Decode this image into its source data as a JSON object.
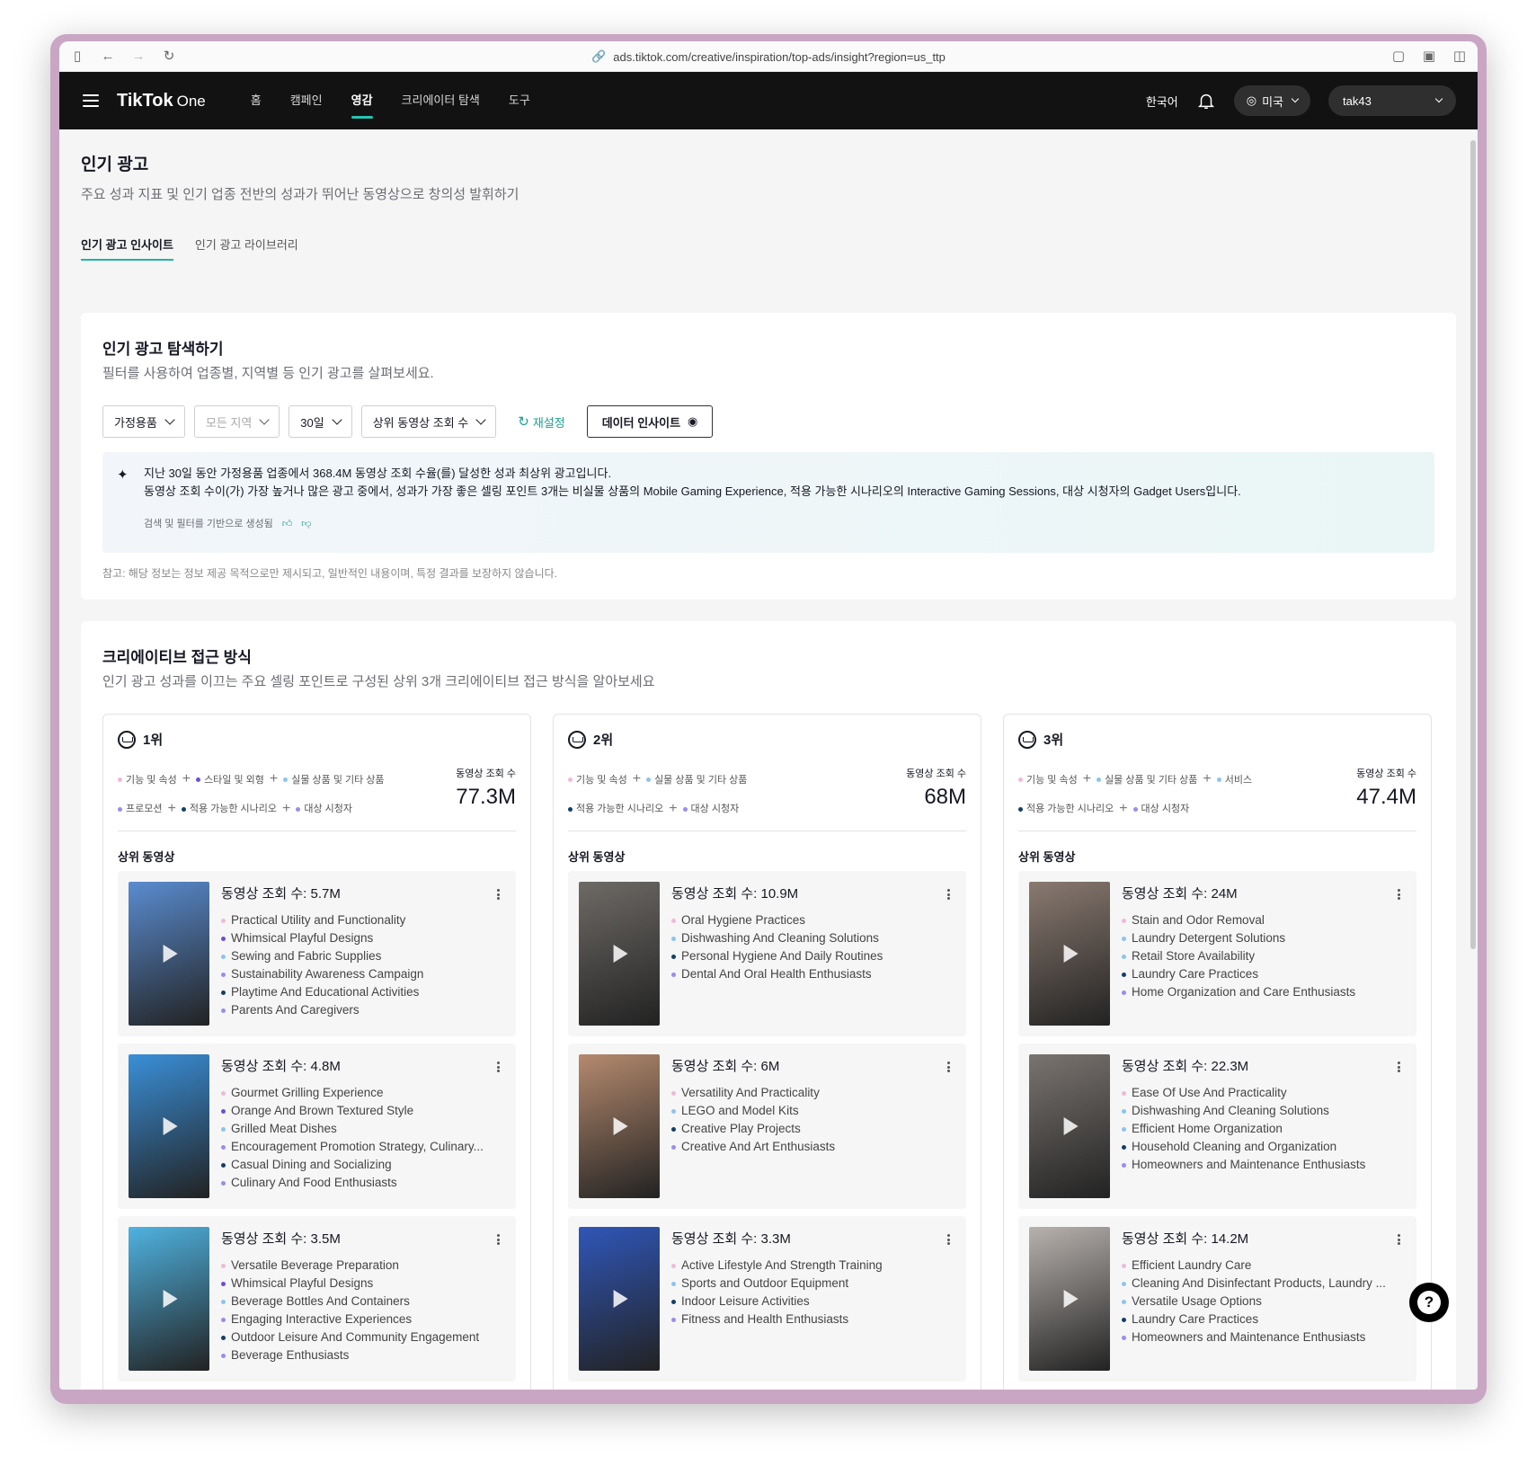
{
  "browser": {
    "url": "ads.tiktok.com/creative/inspiration/top-ads/insight?region=us_ttp"
  },
  "nav": {
    "logo_main": "TikTok",
    "logo_suffix": "One",
    "items": [
      "홈",
      "캠페인",
      "영감",
      "크리에이터 탐색",
      "도구"
    ],
    "active": "영감",
    "language": "한국어",
    "region": "미국",
    "user": "tak43"
  },
  "page": {
    "title": "인기 광고",
    "subtitle": "주요 성과 지표 및 인기 업종 전반의 성과가 뛰어난 동영상으로 창의성 발휘하기",
    "tabs": [
      "인기 광고 인사이트",
      "인기 광고 라이브러리"
    ]
  },
  "explore": {
    "title": "인기 광고 탐색하기",
    "subtitle": "필터를 사용하여 업종별, 지역별 등 인기 광고를 살펴보세요.",
    "filters": {
      "industry": "가정용품",
      "region": "모든 지역",
      "period": "30일",
      "metric": "상위 동영상 조회 수"
    },
    "reset": "재설정",
    "insight_button": "데이터 인사이트",
    "ai_line1": "지난 30일 동안 가정용품 업종에서 368.4M 동영상 조회 수율(를) 달성한 성과 최상위 광고입니다.",
    "ai_line2": "동영상 조회 수이(가) 가장 높거나 많은 광고 중에서, 성과가 가장 좋은 셀링 포인트 3개는 비실물 상품의 Mobile Gaming Experience, 적용 가능한 시나리오의 Interactive Gaming Sessions, 대상 시청자의 Gadget Users입니다.",
    "ai_meta": "검색 및 필터를 기반으로 생성됨",
    "note": "참고: 해당 정보는 정보 제공 목적으로만 제시되고, 일반적인 내용이며, 특정 결과를 보장하지 않습니다."
  },
  "approach": {
    "title": "크리에이티브 접근 방식",
    "subtitle": "인기 광고 성과를 이끄는 주요 셀링 포인트로 구성된 상위 3개 크리에이티브 접근 방식을 알아보세요",
    "views_label": "동영상 조회 수",
    "top_label": "상위 동영상",
    "colors": {
      "pink": "#f0b9d8",
      "purple": "#6a4fd6",
      "lightblue": "#8cc4f0",
      "navy": "#123f6b",
      "lavender": "#9a8cf0"
    },
    "ranks": [
      {
        "rank": "1위",
        "views": "77.3M",
        "tags_line1": [
          {
            "t": "기능 및 속성",
            "c": "pink"
          },
          {
            "t": "스타일 및 외형",
            "c": "purple"
          },
          {
            "t": "실물 상품 및 기타 상품",
            "c": "lightblue"
          }
        ],
        "tags_line2": [
          {
            "t": "프로모션",
            "c": "lavender"
          },
          {
            "t": "적용 가능한 시나리오",
            "c": "navy"
          },
          {
            "t": "대상 시청자",
            "c": "lavender"
          }
        ],
        "videos": [
          {
            "title": "동영상 조회 수: 5.7M",
            "bg": "#5a8cd0",
            "lines": [
              {
                "t": "Practical Utility and Functionality",
                "c": "pink"
              },
              {
                "t": "Whimsical Playful Designs",
                "c": "purple"
              },
              {
                "t": "Sewing and Fabric Supplies",
                "c": "lightblue"
              },
              {
                "t": "Sustainability Awareness Campaign",
                "c": "lavender"
              },
              {
                "t": "Playtime And Educational Activities",
                "c": "navy"
              },
              {
                "t": "Parents And Caregivers",
                "c": "lavender"
              }
            ]
          },
          {
            "title": "동영상 조회 수: 4.8M",
            "bg": "#3a8fd8",
            "lines": [
              {
                "t": "Gourmet Grilling Experience",
                "c": "pink"
              },
              {
                "t": "Orange And Brown Textured Style",
                "c": "purple"
              },
              {
                "t": "Grilled Meat Dishes",
                "c": "lightblue"
              },
              {
                "t": "Encouragement Promotion Strategy, Culinary...",
                "c": "lavender"
              },
              {
                "t": "Casual Dining and Socializing",
                "c": "navy"
              },
              {
                "t": "Culinary And Food Enthusiasts",
                "c": "lavender"
              }
            ]
          },
          {
            "title": "동영상 조회 수: 3.5M",
            "bg": "#4fb2e0",
            "lines": [
              {
                "t": "Versatile Beverage Preparation",
                "c": "pink"
              },
              {
                "t": "Whimsical Playful Designs",
                "c": "purple"
              },
              {
                "t": "Beverage Bottles And Containers",
                "c": "lightblue"
              },
              {
                "t": "Engaging Interactive Experiences",
                "c": "lavender"
              },
              {
                "t": "Outdoor Leisure And Community Engagement",
                "c": "navy"
              },
              {
                "t": "Beverage Enthusiasts",
                "c": "lavender"
              }
            ]
          }
        ]
      },
      {
        "rank": "2위",
        "views": "68M",
        "tags_line1": [
          {
            "t": "기능 및 속성",
            "c": "pink"
          },
          {
            "t": "실물 상품 및 기타 상품",
            "c": "lightblue"
          }
        ],
        "tags_line2": [
          {
            "t": "적용 가능한 시나리오",
            "c": "navy"
          },
          {
            "t": "대상 시청자",
            "c": "lavender"
          }
        ],
        "videos": [
          {
            "title": "동영상 조회 수: 10.9M",
            "bg": "#6e6a66",
            "lines": [
              {
                "t": "Oral Hygiene Practices",
                "c": "pink"
              },
              {
                "t": "Dishwashing And Cleaning Solutions",
                "c": "lightblue"
              },
              {
                "t": "Personal Hygiene And Daily Routines",
                "c": "navy"
              },
              {
                "t": "Dental And Oral Health Enthusiasts",
                "c": "lavender"
              }
            ]
          },
          {
            "title": "동영상 조회 수: 6M",
            "bg": "#b58a6e",
            "lines": [
              {
                "t": "Versatility And Practicality",
                "c": "pink"
              },
              {
                "t": "LEGO and Model Kits",
                "c": "lightblue"
              },
              {
                "t": "Creative Play Projects",
                "c": "navy"
              },
              {
                "t": "Creative And Art Enthusiasts",
                "c": "lavender"
              }
            ]
          },
          {
            "title": "동영상 조회 수: 3.3M",
            "bg": "#2f56b8",
            "lines": [
              {
                "t": "Active Lifestyle And Strength Training",
                "c": "pink"
              },
              {
                "t": "Sports and Outdoor Equipment",
                "c": "lightblue"
              },
              {
                "t": "Indoor Leisure Activities",
                "c": "navy"
              },
              {
                "t": "Fitness and Health Enthusiasts",
                "c": "lavender"
              }
            ]
          }
        ]
      },
      {
        "rank": "3위",
        "views": "47.4M",
        "tags_line1": [
          {
            "t": "기능 및 속성",
            "c": "pink"
          },
          {
            "t": "실물 상품 및 기타 상품",
            "c": "lightblue"
          },
          {
            "t": "서비스",
            "c": "lightblue"
          }
        ],
        "tags_line2": [
          {
            "t": "적용 가능한 시나리오",
            "c": "navy"
          },
          {
            "t": "대상 시청자",
            "c": "lavender"
          }
        ],
        "videos": [
          {
            "title": "동영상 조회 수: 24M",
            "bg": "#8a7a70",
            "lines": [
              {
                "t": "Stain and Odor Removal",
                "c": "pink"
              },
              {
                "t": "Laundry Detergent Solutions",
                "c": "lightblue"
              },
              {
                "t": "Retail Store Availability",
                "c": "lightblue"
              },
              {
                "t": "Laundry Care Practices",
                "c": "navy"
              },
              {
                "t": "Home Organization and Care Enthusiasts",
                "c": "lavender"
              }
            ]
          },
          {
            "title": "동영상 조회 수: 22.3M",
            "bg": "#7a7470",
            "lines": [
              {
                "t": "Ease Of Use And Practicality",
                "c": "pink"
              },
              {
                "t": "Dishwashing And Cleaning Solutions",
                "c": "lightblue"
              },
              {
                "t": "Efficient Home Organization",
                "c": "lightblue"
              },
              {
                "t": "Household Cleaning and Organization",
                "c": "navy"
              },
              {
                "t": "Homeowners and Maintenance Enthusiasts",
                "c": "lavender"
              }
            ]
          },
          {
            "title": "동영상 조회 수: 14.2M",
            "bg": "#b8b2ae",
            "lines": [
              {
                "t": "Efficient Laundry Care",
                "c": "pink"
              },
              {
                "t": "Cleaning And Disinfectant Products, Laundry ...",
                "c": "lightblue"
              },
              {
                "t": "Versatile Usage Options",
                "c": "lightblue"
              },
              {
                "t": "Laundry Care Practices",
                "c": "navy"
              },
              {
                "t": "Homeowners and Maintenance Enthusiasts",
                "c": "lavender"
              }
            ]
          }
        ]
      }
    ]
  }
}
